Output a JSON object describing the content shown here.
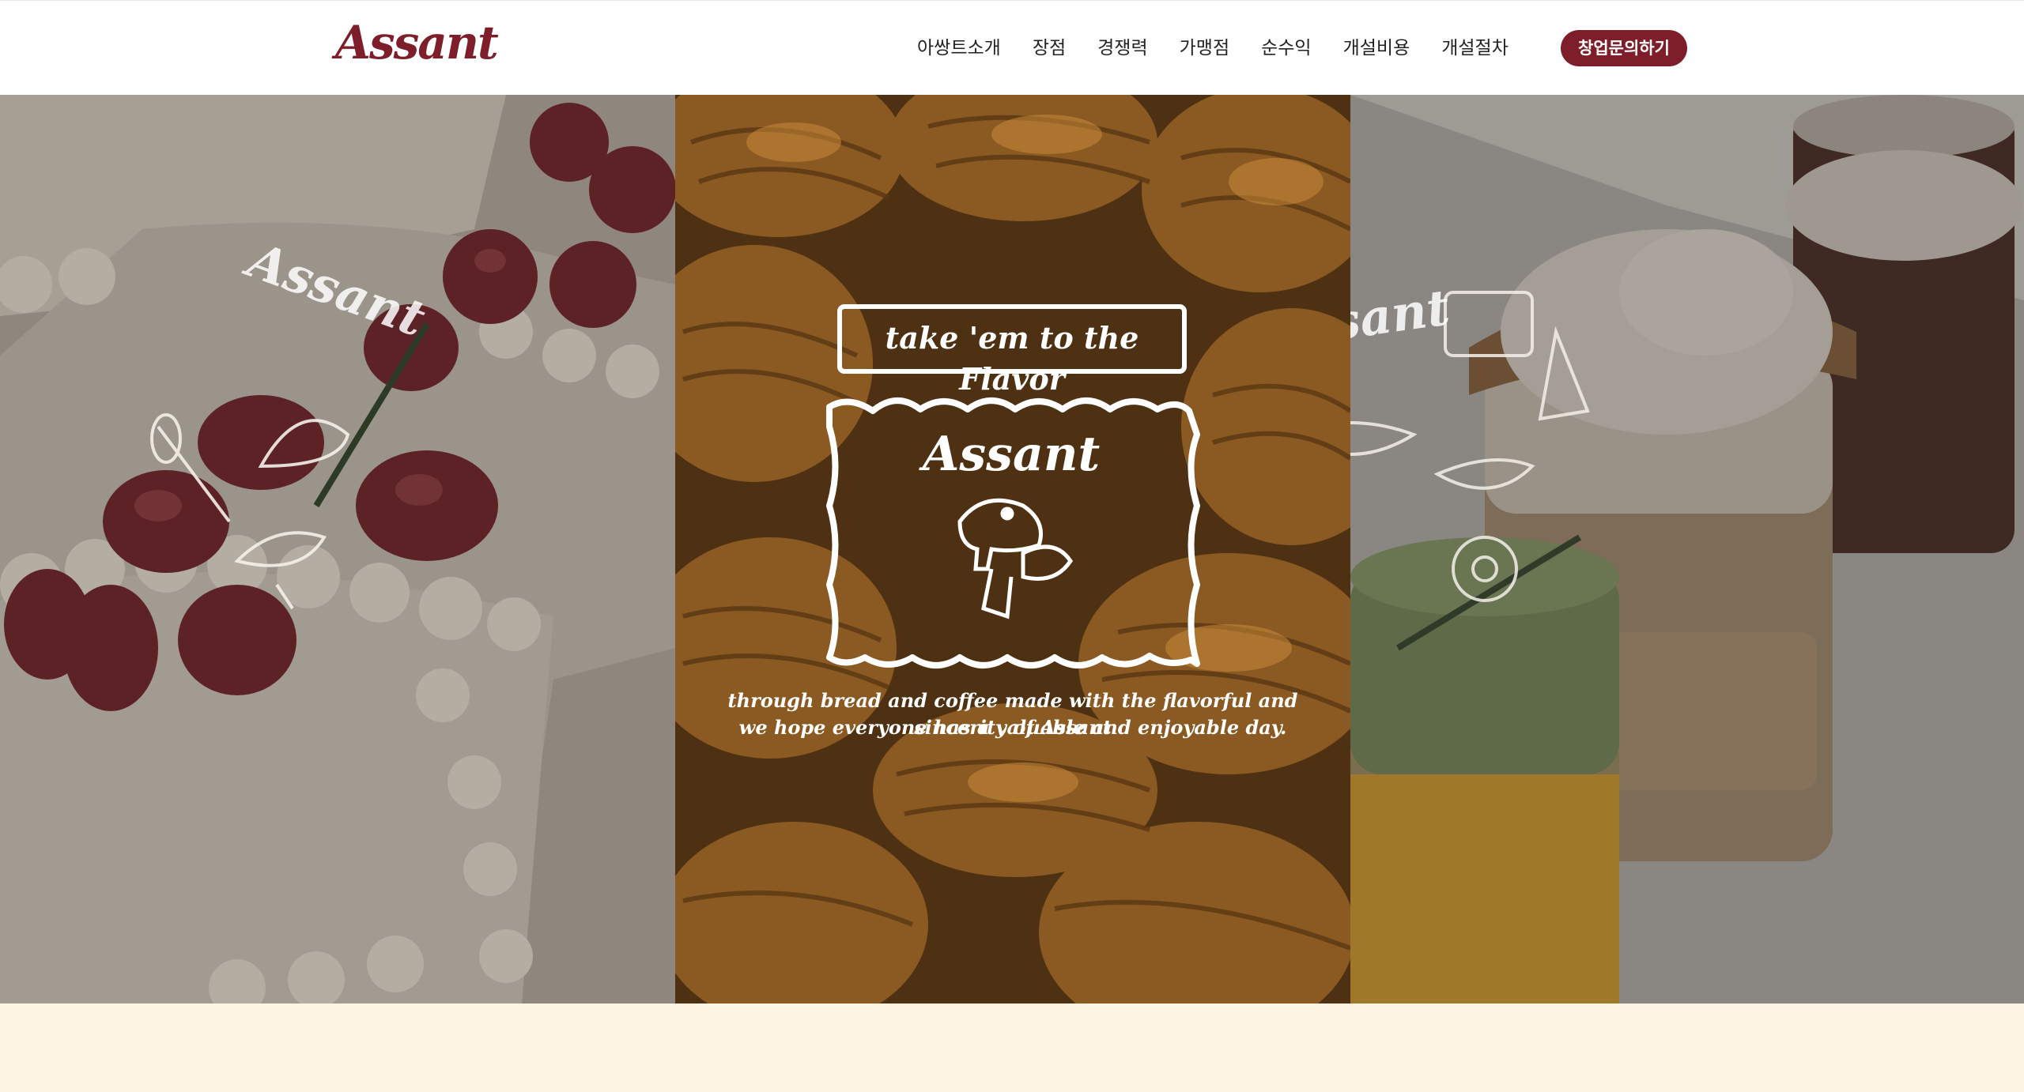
{
  "header": {
    "logo": "Assant",
    "nav": [
      {
        "label": "아쌍트소개"
      },
      {
        "label": "장점"
      },
      {
        "label": "경쟁력"
      },
      {
        "label": "가맹점"
      },
      {
        "label": "순수익"
      },
      {
        "label": "개설비용"
      },
      {
        "label": "개설절차"
      }
    ],
    "cta_label": "창업문의하기"
  },
  "hero": {
    "left_logo": "Assant",
    "center_banner": "take 'em to the Flavor",
    "center_logo": "Assant",
    "tagline_line1": "through bread and coffee made with the flavorful and sincerity of Assant",
    "tagline_line2": "we hope everyone has a valuable and enjoyable day.",
    "right_logo": "Assant"
  },
  "colors": {
    "brand": "#7d1e2a",
    "cream": "#fdf4e3"
  }
}
